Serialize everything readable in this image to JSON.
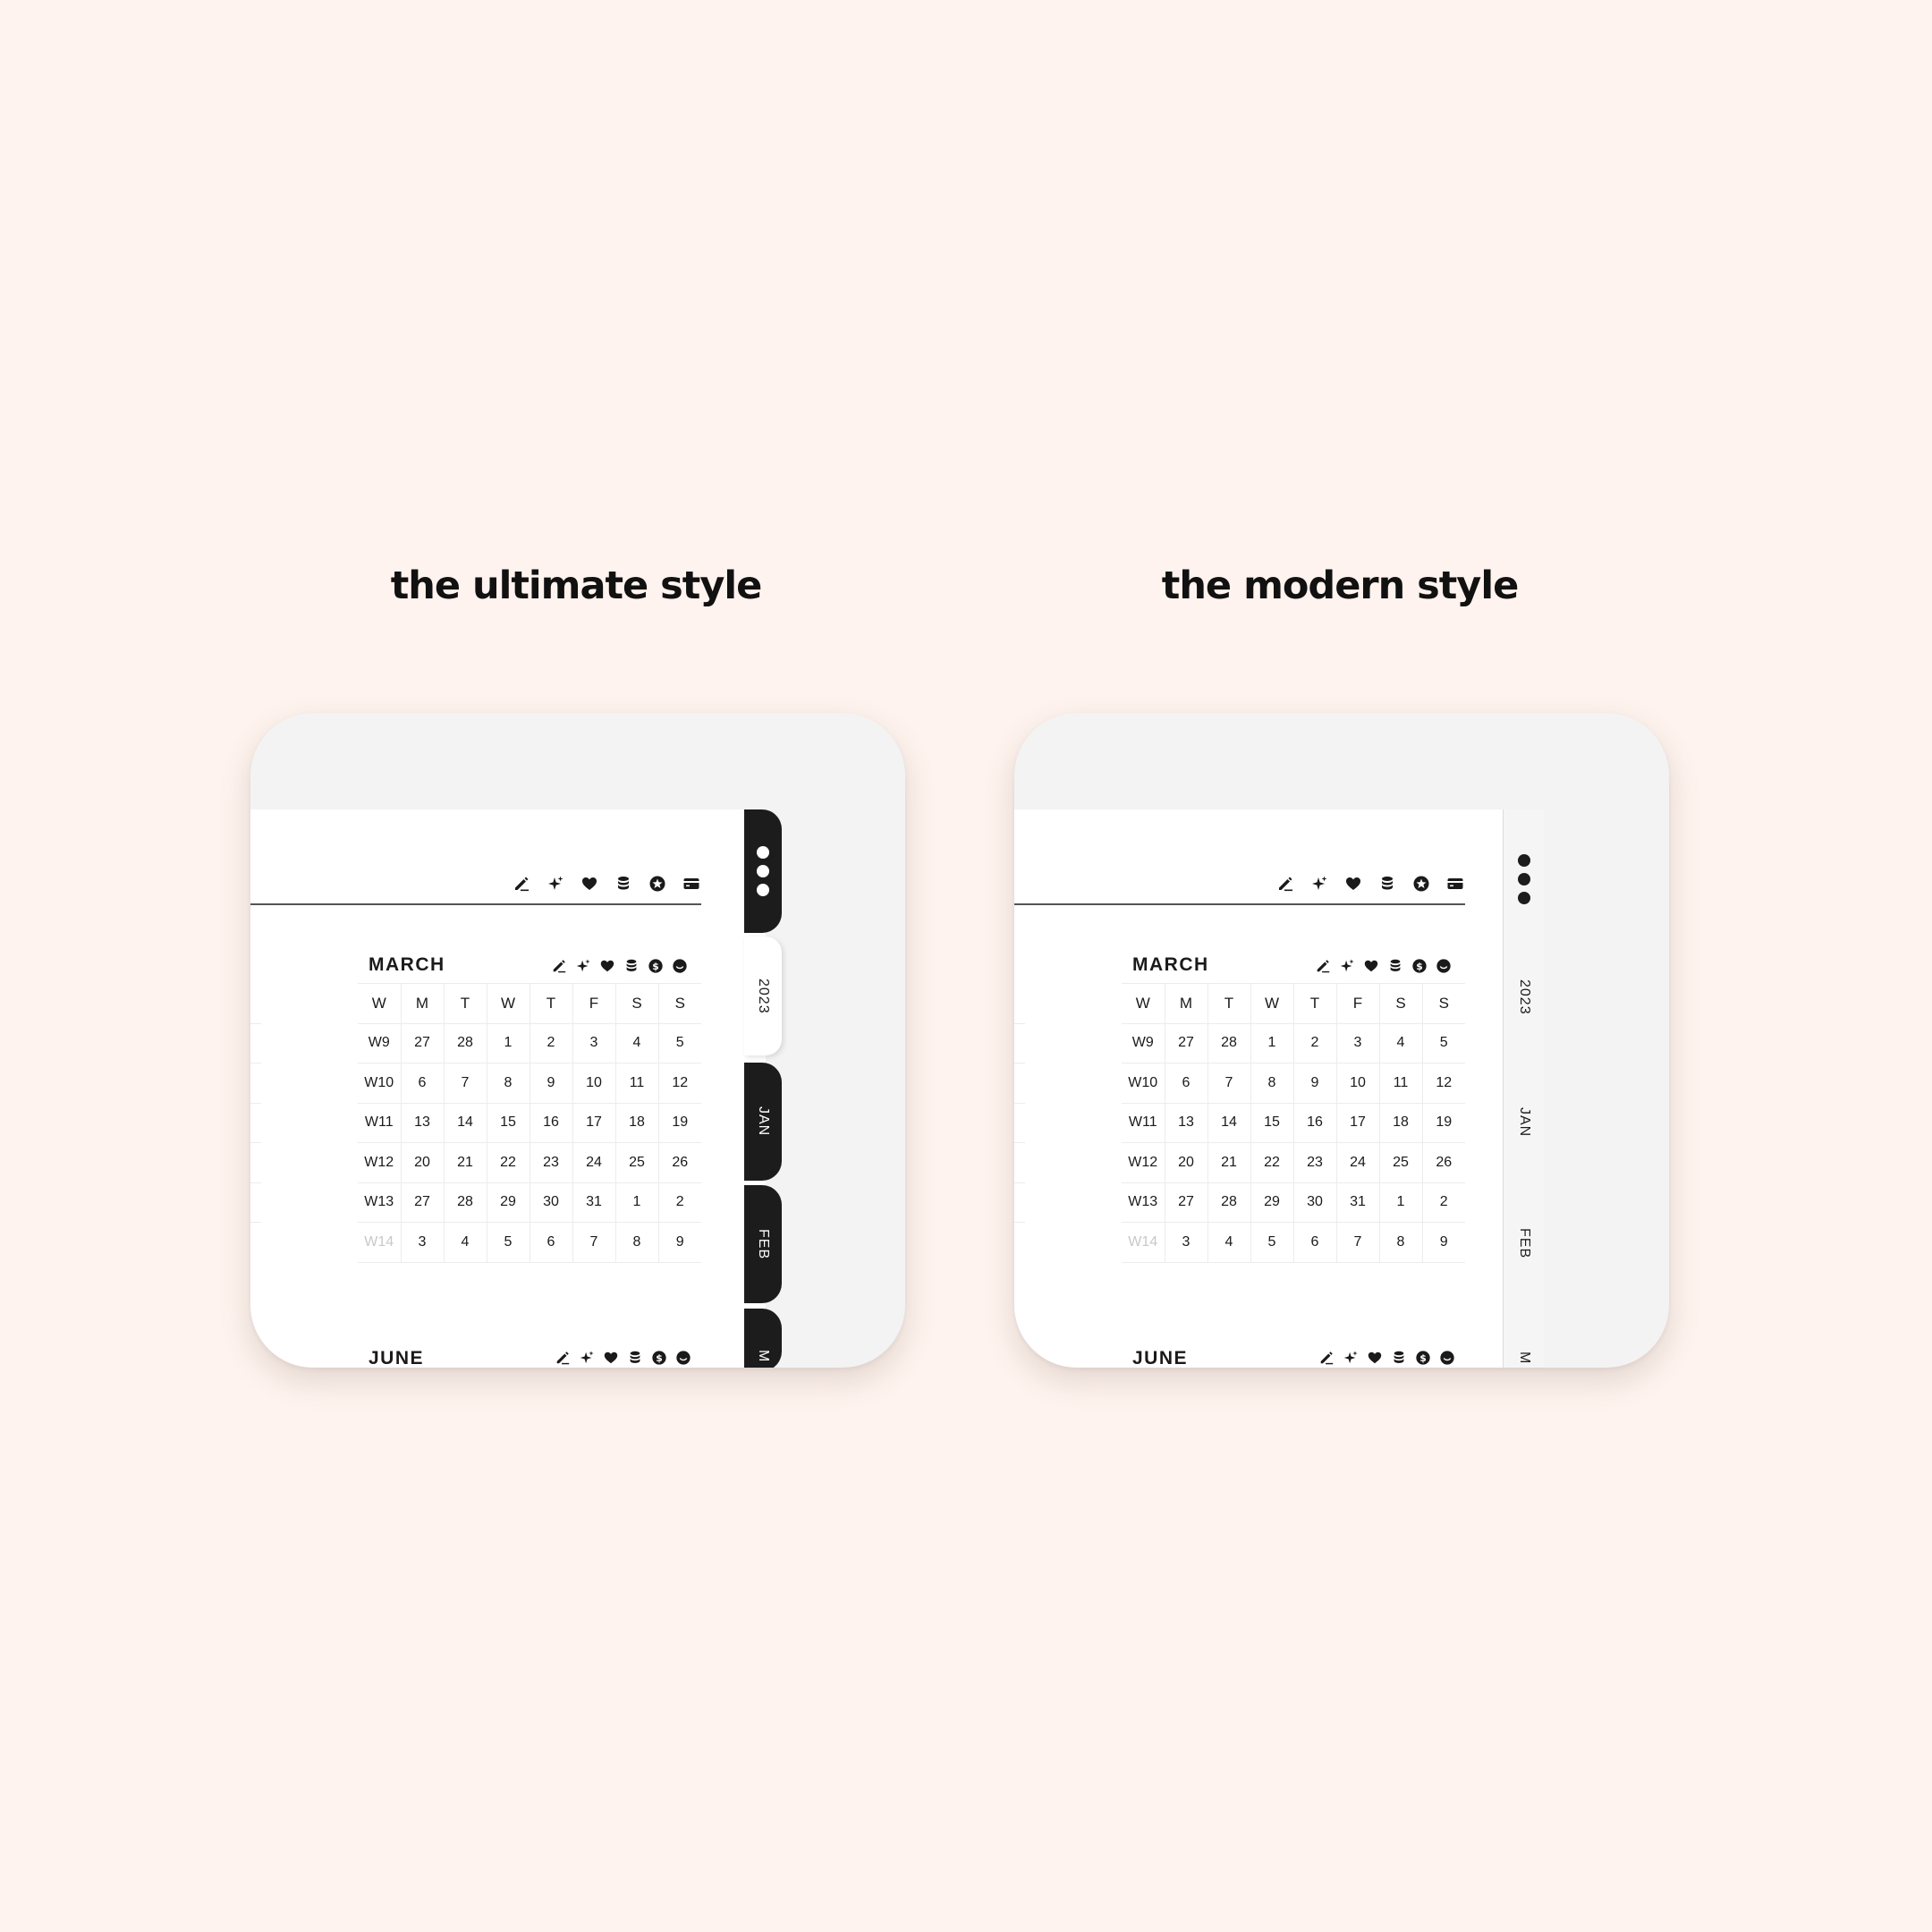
{
  "panels": [
    {
      "title": "the ultimate style",
      "style": "ultimate"
    },
    {
      "title": "the modern style",
      "style": "modern"
    }
  ],
  "header_icons": [
    "pencil-icon",
    "sparkle-icon",
    "heart-icon",
    "coins-icon",
    "star-icon",
    "card-icon"
  ],
  "month_icons": [
    "pencil-icon",
    "sparkle-icon",
    "heart-icon",
    "coins-icon",
    "dollar-icon",
    "smile-icon"
  ],
  "calendar": {
    "month": "MARCH",
    "weekdays": [
      "W",
      "M",
      "T",
      "W",
      "T",
      "F",
      "S",
      "S"
    ],
    "rows": [
      {
        "week": "W9",
        "days": [
          "27",
          "28",
          "1",
          "2",
          "3",
          "4",
          "5"
        ],
        "muted": [
          true,
          true,
          false,
          false,
          false,
          false,
          false
        ],
        "week_muted": false
      },
      {
        "week": "W10",
        "days": [
          "6",
          "7",
          "8",
          "9",
          "10",
          "11",
          "12"
        ],
        "muted": [
          false,
          false,
          false,
          false,
          false,
          false,
          false
        ],
        "week_muted": false
      },
      {
        "week": "W11",
        "days": [
          "13",
          "14",
          "15",
          "16",
          "17",
          "18",
          "19"
        ],
        "muted": [
          false,
          false,
          false,
          false,
          false,
          false,
          false
        ],
        "week_muted": false
      },
      {
        "week": "W12",
        "days": [
          "20",
          "21",
          "22",
          "23",
          "24",
          "25",
          "26"
        ],
        "muted": [
          false,
          false,
          false,
          false,
          false,
          false,
          false
        ],
        "week_muted": false
      },
      {
        "week": "W13",
        "days": [
          "27",
          "28",
          "29",
          "30",
          "31",
          "1",
          "2"
        ],
        "muted": [
          false,
          false,
          false,
          false,
          false,
          true,
          true
        ],
        "week_muted": false
      },
      {
        "week": "W14",
        "days": [
          "3",
          "4",
          "5",
          "6",
          "7",
          "8",
          "9"
        ],
        "muted": [
          true,
          true,
          true,
          true,
          true,
          true,
          true
        ],
        "week_muted": true
      }
    ],
    "next_month": "JUNE"
  },
  "tabs": {
    "year": "2023",
    "months": [
      "JAN",
      "FEB",
      "M"
    ]
  },
  "colors": {
    "background": "#fef3ee",
    "tab_dark": "#1c1c1c",
    "muted_text": "#c8c8c8"
  }
}
